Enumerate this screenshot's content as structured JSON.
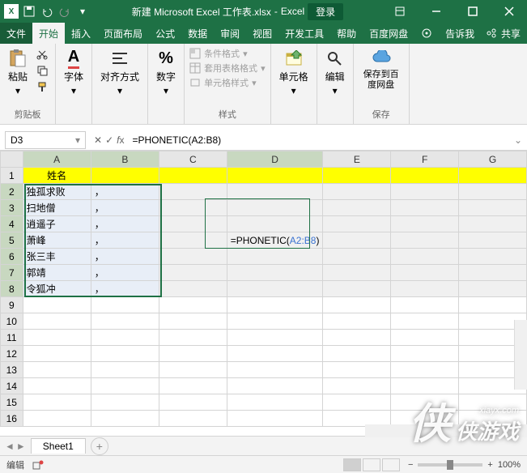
{
  "title": {
    "filename": "新建 Microsoft Excel 工作表.xlsx",
    "app": "Excel",
    "login": "登录"
  },
  "menu": {
    "file": "文件",
    "home": "开始",
    "insert": "插入",
    "layout": "页面布局",
    "formula": "公式",
    "data": "数据",
    "review": "审阅",
    "view": "视图",
    "dev": "开发工具",
    "help": "帮助",
    "baidu": "百度网盘",
    "tellme": "告诉我",
    "share": "共享"
  },
  "ribbon": {
    "clipboard": "剪贴板",
    "paste": "粘贴",
    "font": "字体",
    "align": "对齐方式",
    "number": "数字",
    "styles": "样式",
    "cond_fmt": "条件格式",
    "table_fmt": "套用表格格式",
    "cell_fmt": "单元格样式",
    "cells": "单元格",
    "editing": "编辑",
    "save_baidu": "保存到百度网盘",
    "save_group": "保存"
  },
  "formula_bar": {
    "name": "D3",
    "formula": "=PHONETIC(A2:B8)"
  },
  "columns": [
    "A",
    "B",
    "C",
    "D",
    "E",
    "F",
    "G"
  ],
  "rows": [
    "1",
    "2",
    "3",
    "4",
    "5",
    "6",
    "7",
    "8",
    "9",
    "10",
    "11",
    "12",
    "13",
    "14",
    "15",
    "16"
  ],
  "data": {
    "header": "姓名",
    "names": [
      "独孤求败",
      "扫地僧",
      "逍遥子",
      "萧峰",
      "张三丰",
      "郭靖",
      "令狐冲"
    ],
    "comma": "，",
    "edit_cell_display": "=PHONETIC(A2:B8)"
  },
  "sheet": {
    "name": "Sheet1"
  },
  "status": {
    "mode": "编辑",
    "zoom": "100%",
    "plus": "+"
  },
  "watermark": {
    "url": "xiayx.com",
    "brand": "侠游戏"
  }
}
